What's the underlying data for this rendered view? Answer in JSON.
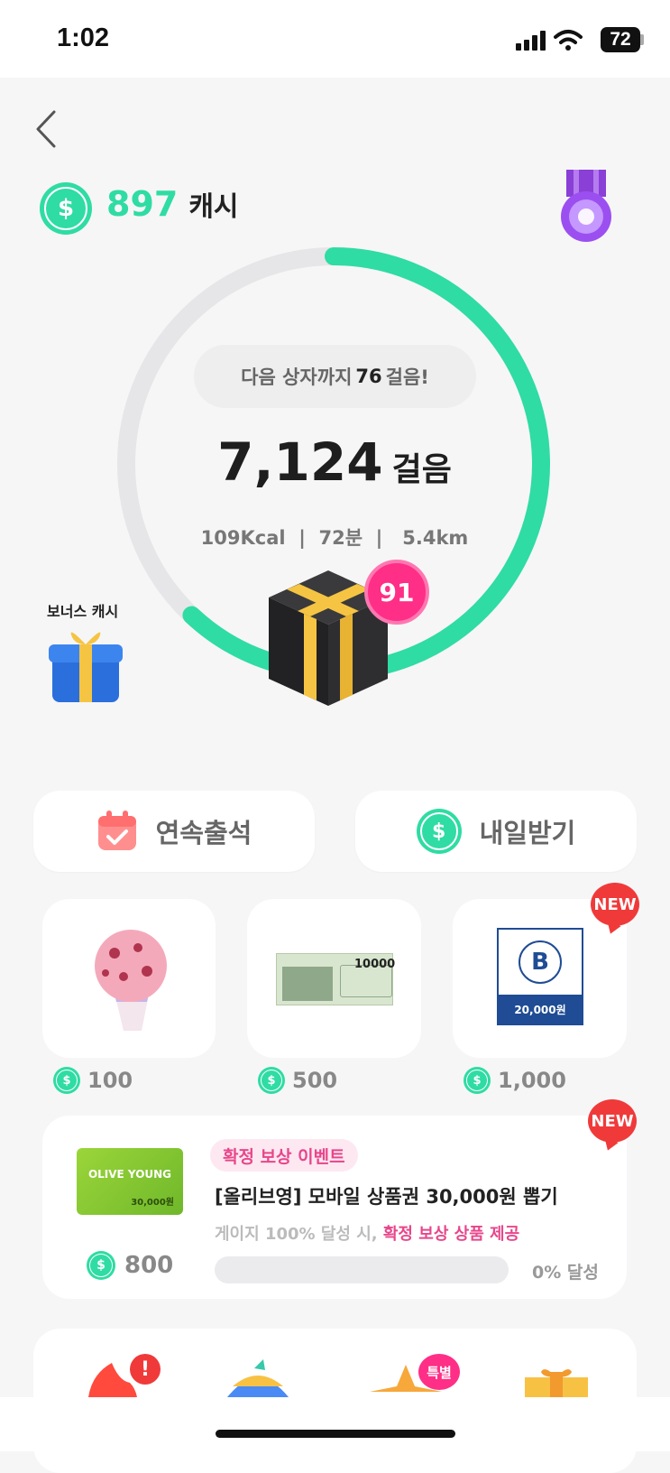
{
  "status_bar": {
    "time": "1:02",
    "battery": "72"
  },
  "header": {
    "cash_amount": "897",
    "cash_unit": "캐시"
  },
  "progress": {
    "next_box_prefix": "다음 상자까지",
    "next_box_steps": "76",
    "next_box_suffix": "걸음!",
    "steps": "7,124",
    "steps_unit": "걸음",
    "stats": "109Kcal  |  72분  |   5.4km",
    "ring_fraction": 0.62,
    "box_count": "91"
  },
  "bonus": {
    "label": "보너스 캐시"
  },
  "actions": {
    "attendance": "연속출석",
    "tomorrow": "내일받기"
  },
  "products": [
    {
      "name": "ice-cream",
      "price": "100",
      "new": false
    },
    {
      "name": "gift-voucher",
      "voucher_amount": "10000",
      "price": "500",
      "new": false
    },
    {
      "name": "paris-baguette",
      "voucher_amount": "20,000원",
      "price": "1,000",
      "new": true
    }
  ],
  "new_label": "NEW",
  "event": {
    "tag": "확정 보상 이벤트",
    "title": "[올리브영] 모바일 상품권 30,000원 뽑기",
    "sub_plain": "게이지 100% 달성 시, ",
    "sub_highlight": "확정 보상 상품 제공",
    "price": "800",
    "gauge_percent": 0,
    "gauge_label": "0% 달성",
    "card_brand": "OLIVE YOUNG",
    "card_amount": "30,000원"
  },
  "bottom": {
    "special_badge": "특별",
    "alert_badge": "!"
  },
  "colors": {
    "accent": "#2fdca3",
    "pink": "#e8468b",
    "new_red": "#f03a3a"
  }
}
